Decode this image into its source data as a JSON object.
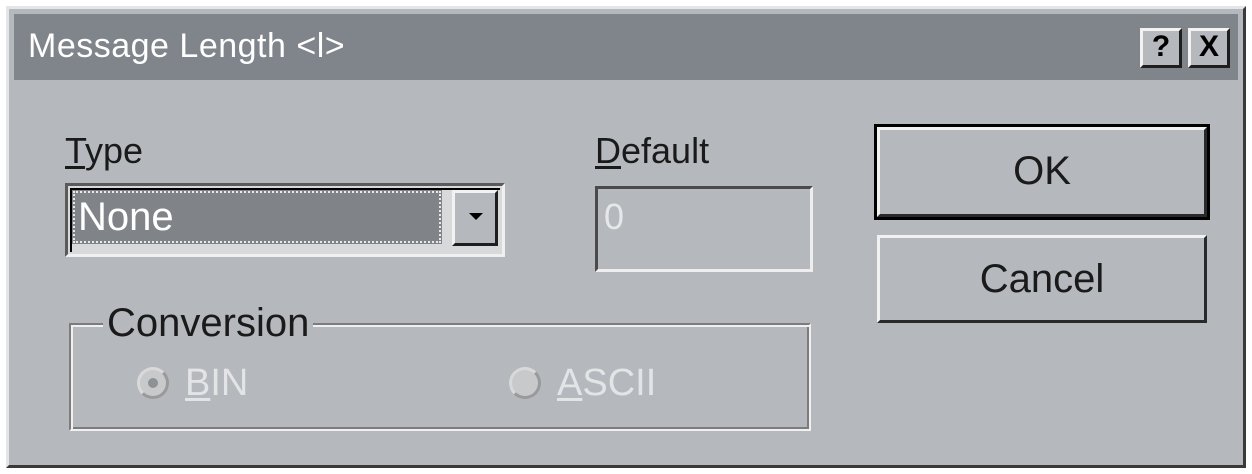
{
  "window": {
    "title": "Message Length <l>",
    "help_button": "?",
    "close_button": "X"
  },
  "type_field": {
    "label_mnemonic": "T",
    "label_rest": "ype",
    "selected_value": "None"
  },
  "default_field": {
    "label_mnemonic": "D",
    "label_rest": "efault",
    "value": "0",
    "enabled": false
  },
  "buttons": {
    "ok_label": "OK",
    "cancel_label": "Cancel"
  },
  "conversion": {
    "group_label": "Conversion",
    "options": [
      {
        "mnemonic": "B",
        "rest": "IN",
        "selected": true,
        "enabled": false
      },
      {
        "mnemonic": "A",
        "rest": "SCII",
        "selected": false,
        "enabled": false
      }
    ]
  },
  "colors": {
    "dialog_face": "#b5b8bc",
    "titlebar": "#7f858a",
    "selection": "#808489",
    "disabled_text": "#e3e4e6"
  }
}
